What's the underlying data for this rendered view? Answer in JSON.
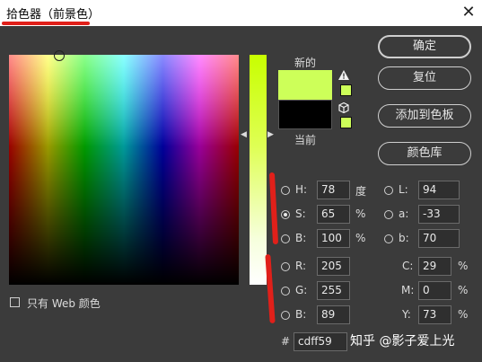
{
  "window": {
    "title": "拾色器（前景色）",
    "close_symbol": "✕"
  },
  "swatches": {
    "new_label": "新的",
    "current_label": "当前",
    "new_color": "#cdff59",
    "current_color": "#000000"
  },
  "buttons": {
    "ok": "确定",
    "reset": "复位",
    "add_to_swatches": "添加到色板",
    "color_libraries": "颜色库"
  },
  "hsb": {
    "h": {
      "label": "H:",
      "value": "78",
      "unit": "度"
    },
    "s": {
      "label": "S:",
      "value": "65",
      "unit": "%"
    },
    "b": {
      "label": "B:",
      "value": "100",
      "unit": "%"
    },
    "selected": "S"
  },
  "lab": {
    "l": {
      "label": "L:",
      "value": "94"
    },
    "a": {
      "label": "a:",
      "value": "-33"
    },
    "b": {
      "label": "b:",
      "value": "70"
    }
  },
  "rgb": {
    "r": {
      "label": "R:",
      "value": "205"
    },
    "g": {
      "label": "G:",
      "value": "255"
    },
    "b": {
      "label": "B:",
      "value": "89"
    }
  },
  "cmyk": {
    "c": {
      "label": "C:",
      "value": "29",
      "unit": "%"
    },
    "m": {
      "label": "M:",
      "value": "0",
      "unit": "%"
    },
    "y": {
      "label": "Y:",
      "value": "73",
      "unit": "%"
    }
  },
  "hex": {
    "label": "#",
    "value": "cdff59"
  },
  "web_only": {
    "label": "只有 Web 颜色",
    "checked": false
  },
  "icons": {
    "warning": "warning-triangle-icon",
    "cube": "web-safe-cube-icon"
  },
  "watermark": "知乎 @影子爱上光",
  "annotation_color": "#e0201a"
}
